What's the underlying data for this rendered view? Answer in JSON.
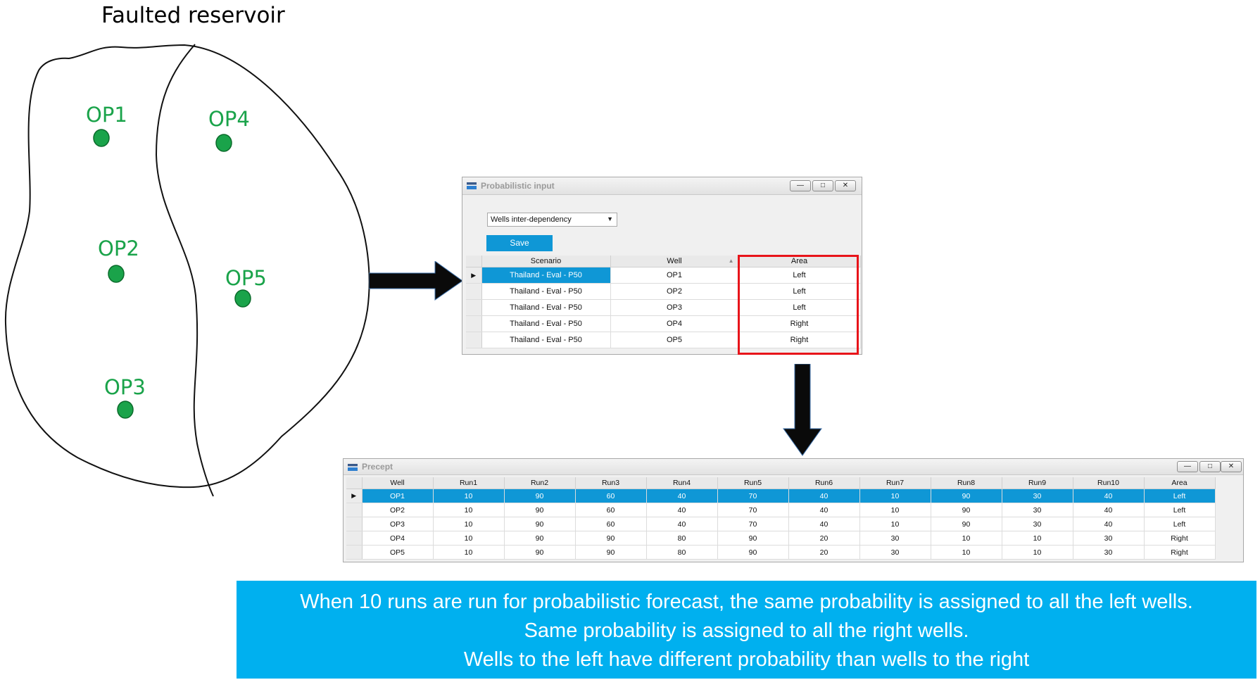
{
  "sketch": {
    "title": "Faulted reservoir",
    "wells": [
      "OP1",
      "OP2",
      "OP3",
      "OP4",
      "OP5"
    ],
    "colors": {
      "well": "#1aa34a"
    }
  },
  "prob_window": {
    "title": "Probabilistic input",
    "dropdown_value": "Wells inter-dependency",
    "save_label": "Save",
    "columns": [
      "Scenario",
      "Well",
      "Area"
    ],
    "rows": [
      [
        "Thailand - Eval - P50",
        "OP1",
        "Left"
      ],
      [
        "Thailand - Eval - P50",
        "OP2",
        "Left"
      ],
      [
        "Thailand - Eval - P50",
        "OP3",
        "Left"
      ],
      [
        "Thailand - Eval - P50",
        "OP4",
        "Right"
      ],
      [
        "Thailand - Eval - P50",
        "OP5",
        "Right"
      ]
    ],
    "colors": {
      "selection": "#0f97d6",
      "save": "#0f97d6",
      "highlight_box": "#e8141a"
    }
  },
  "precept_window": {
    "title": "Precept",
    "columns": [
      "Well",
      "Run1",
      "Run2",
      "Run3",
      "Run4",
      "Run5",
      "Run6",
      "Run7",
      "Run8",
      "Run9",
      "Run10",
      "Area"
    ],
    "rows": [
      [
        "OP1",
        "10",
        "90",
        "60",
        "40",
        "70",
        "40",
        "10",
        "90",
        "30",
        "40",
        "Left"
      ],
      [
        "OP2",
        "10",
        "90",
        "60",
        "40",
        "70",
        "40",
        "10",
        "90",
        "30",
        "40",
        "Left"
      ],
      [
        "OP3",
        "10",
        "90",
        "60",
        "40",
        "70",
        "40",
        "10",
        "90",
        "30",
        "40",
        "Left"
      ],
      [
        "OP4",
        "10",
        "90",
        "90",
        "80",
        "90",
        "20",
        "30",
        "10",
        "10",
        "30",
        "Right"
      ],
      [
        "OP5",
        "10",
        "90",
        "90",
        "80",
        "90",
        "20",
        "30",
        "10",
        "10",
        "30",
        "Right"
      ]
    ]
  },
  "caption": {
    "lines": [
      "When 10 runs are run for probabilistic forecast, the same probability is assigned to all the left wells.",
      "Same probability is assigned to all the right wells.",
      "Wells to the left have different probability than wells to the right"
    ],
    "background": "#00b0ef"
  }
}
